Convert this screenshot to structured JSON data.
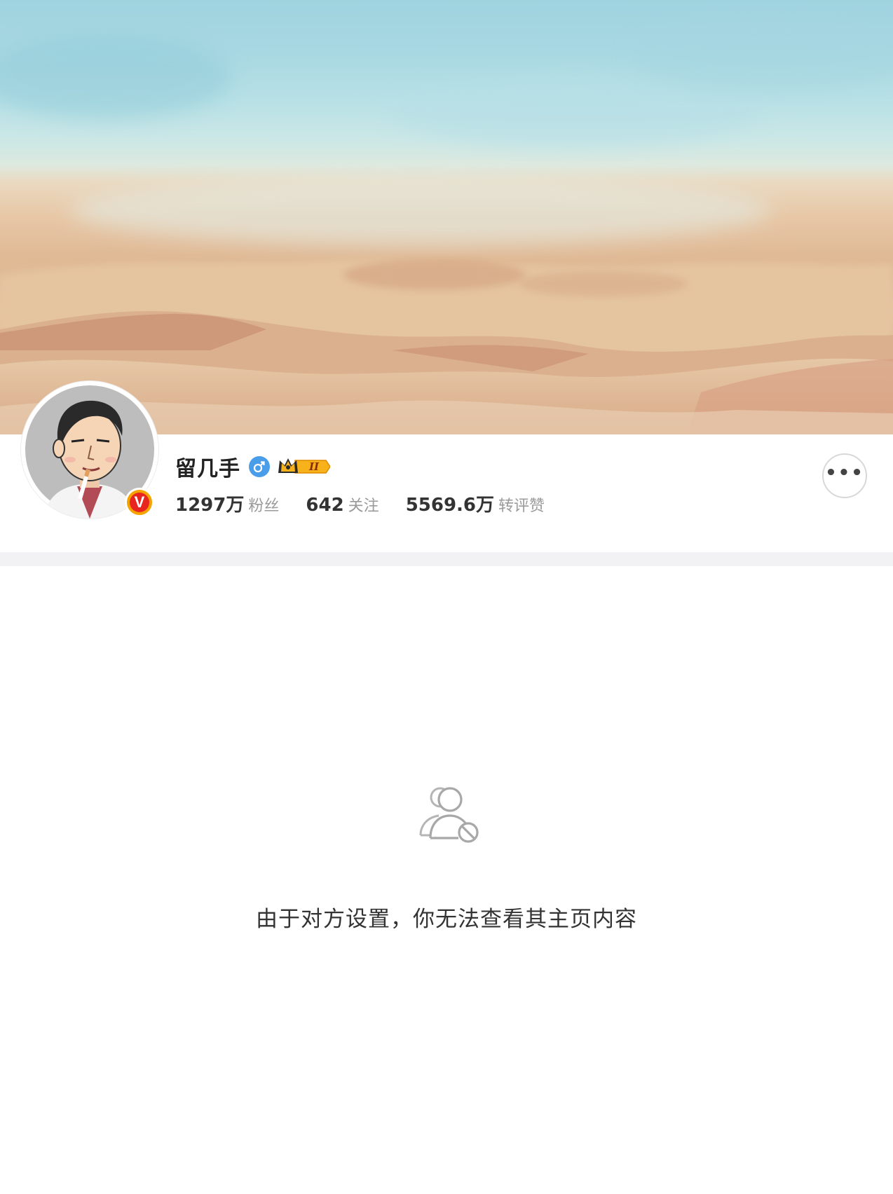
{
  "profile": {
    "name": "留几手",
    "gender": "male",
    "verified": "V",
    "vip_level": "II",
    "stats": [
      {
        "value": "1297万",
        "label": "粉丝"
      },
      {
        "value": "642",
        "label": "关注"
      },
      {
        "value": "5569.6万",
        "label": "转评赞"
      }
    ]
  },
  "actions": {
    "more": "•••"
  },
  "empty_state": {
    "icon": "user-blocked-icon",
    "message": "由于对方设置，你无法查看其主页内容"
  },
  "colors": {
    "accent_blue": "#4a9de8",
    "verified_orange": "#f5a300",
    "text_primary": "#333333",
    "text_secondary": "#9a9a9a"
  }
}
